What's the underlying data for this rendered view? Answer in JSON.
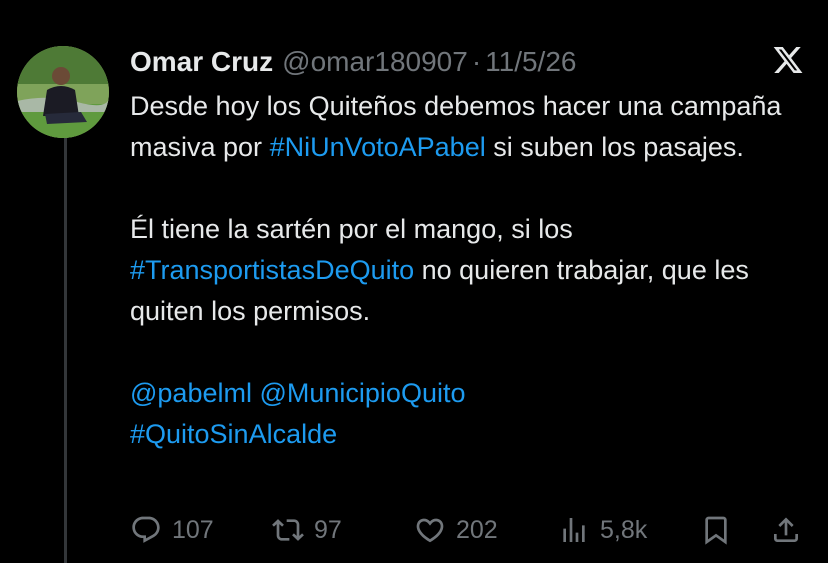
{
  "tweet": {
    "author_name": "Omar Cruz",
    "handle": "@omar180907",
    "separator": "·",
    "date": "11/5/26",
    "para1": {
      "text1": "Desde hoy los Quiteños debemos hacer una campaña masiva por ",
      "hashtag1": "#NiUnVotoAPabel",
      "text2": " si suben los pasajes."
    },
    "para2": {
      "text1": "Él tiene la sartén por el mango, si los ",
      "hashtag2": "#TransportistasDeQuito",
      "text2": " no quieren trabajar, que les quiten los permisos."
    },
    "para3": {
      "mention1": "@pabelml",
      "mention2": "@MunicipioQuito",
      "hashtag3": "#QuitoSinAlcalde"
    }
  },
  "actions": {
    "replies": "107",
    "reposts": "97",
    "likes": "202",
    "views": "5,8k"
  },
  "icons": {
    "platform": "x-logo-icon",
    "reply": "reply-icon",
    "repost": "repost-icon",
    "like": "heart-icon",
    "views": "views-icon",
    "bookmark": "bookmark-icon",
    "share": "share-icon"
  },
  "colors": {
    "background": "#000000",
    "text": "#e7e9ea",
    "muted": "#71767b",
    "link": "#1d9bf0"
  }
}
